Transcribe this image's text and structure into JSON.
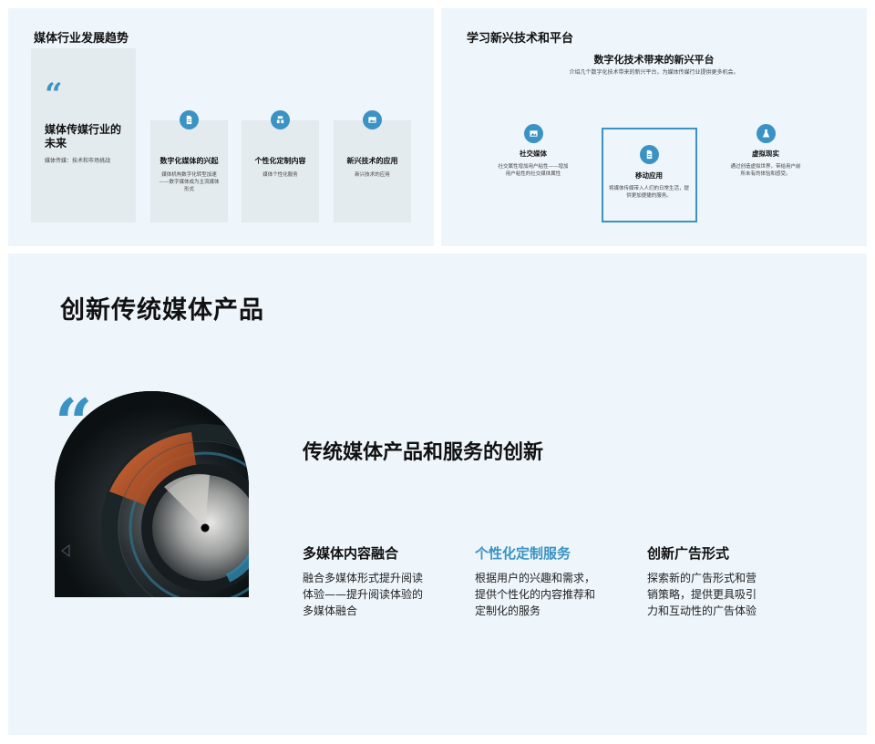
{
  "slide1": {
    "title": "媒体行业发展趋势",
    "quote_card": {
      "title": "媒体传媒行业的未来",
      "subtitle": "媒体传媒：技术和市场挑战"
    },
    "cards": [
      {
        "icon": "document-icon",
        "label": "数字化媒体的兴起",
        "desc": "媒体机构数字化转型加速——数字媒体成为主流媒体形式"
      },
      {
        "icon": "layers-icon",
        "label": "个性化定制内容",
        "desc": "媒体个性化服务"
      },
      {
        "icon": "image-icon",
        "label": "新兴技术的应用",
        "desc": "新兴技术的应用"
      }
    ]
  },
  "slide2": {
    "title": "学习新兴技术和平台",
    "subtitle": "数字化技术带来的新兴平台",
    "desc": "介绍几个数字化技术带来的新兴平台，为媒体传媒行业提供更多机会。",
    "items": [
      {
        "icon": "image-icon",
        "label": "社交媒体",
        "desc": "社交属性增加用户粘性——增加用户粘性的社交媒体属性"
      },
      {
        "icon": "document-icon",
        "label": "移动应用",
        "desc": "将媒体传媒带入人们的日常生活，提供更加便捷的服务。"
      },
      {
        "icon": "flask-icon",
        "label": "虚拟现实",
        "desc": "通过创造虚拟世界，带给用户前所未有的体验和感受。"
      }
    ]
  },
  "slide3": {
    "title": "创新传统媒体产品",
    "subtitle": "传统媒体产品和服务的创新",
    "columns": [
      {
        "heading": "多媒体内容融合",
        "text": "融合多媒体形式提升阅读体验——提升阅读体验的多媒体融合"
      },
      {
        "heading": "个性化定制服务",
        "text": "根据用户的兴趣和需求，提供个性化的内容推荐和定制化的服务"
      },
      {
        "heading": "创新广告形式",
        "text": "探索新的广告形式和营销策略，提供更具吸引力和互动性的广告体验"
      }
    ]
  },
  "colors": {
    "accent": "#3a93c4",
    "slide_bg": "#eef5fb",
    "card_bg": "#e4ebef"
  }
}
